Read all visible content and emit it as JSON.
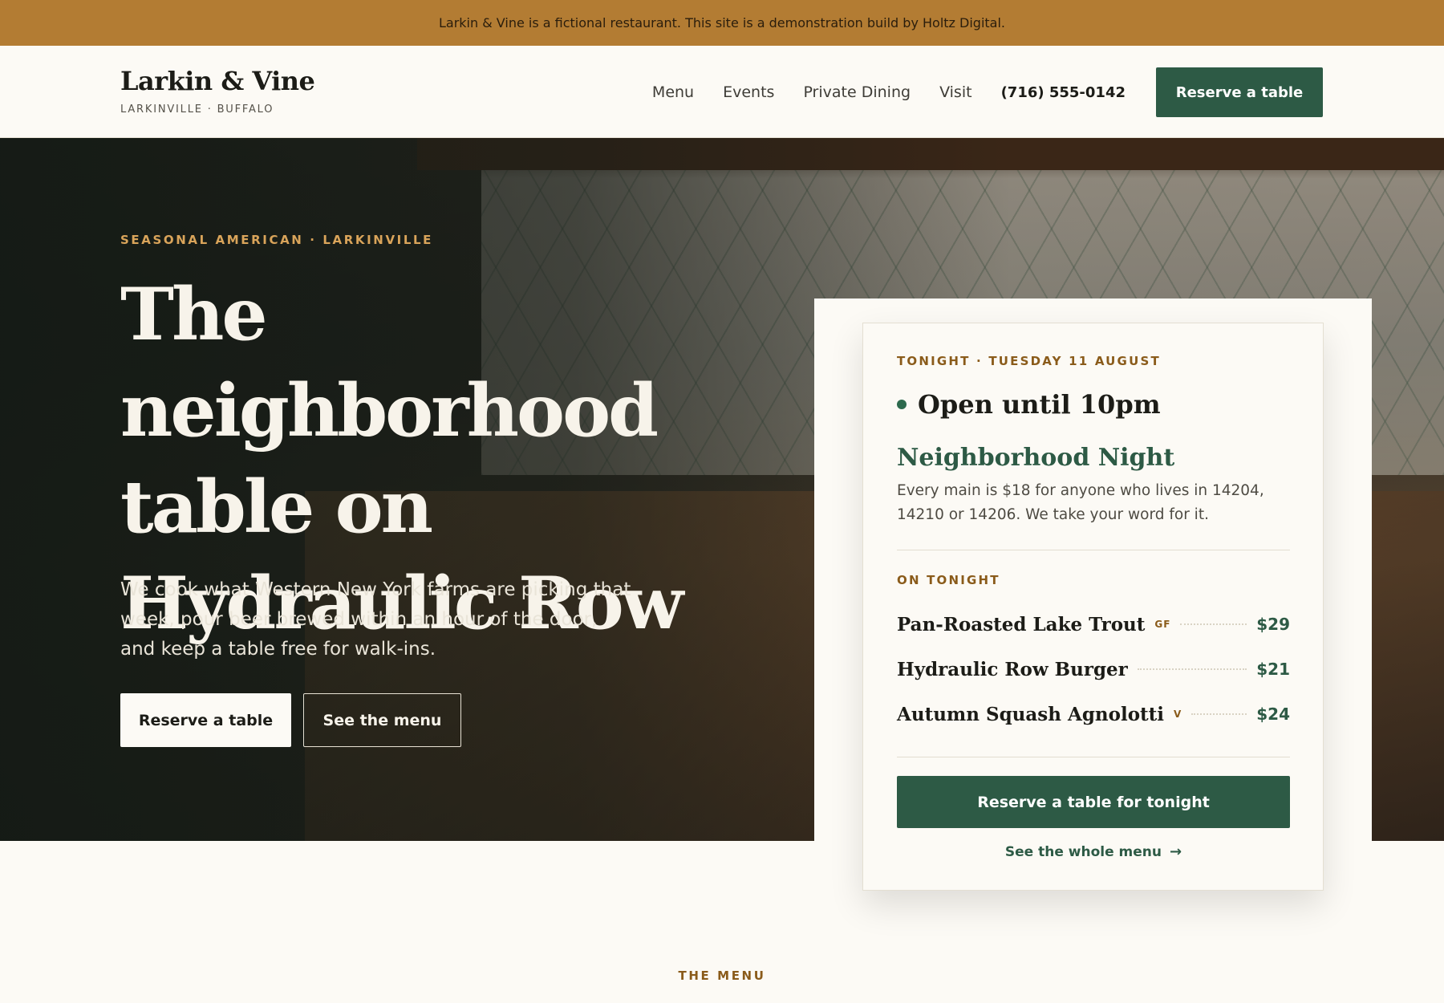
{
  "announcement": "Larkin & Vine is a fictional restaurant. This site is a demonstration build by Holtz Digital.",
  "brand": {
    "name": "Larkin & Vine",
    "sub": "LARKINVILLE · BUFFALO"
  },
  "nav": {
    "items": [
      {
        "label": "Menu"
      },
      {
        "label": "Events"
      },
      {
        "label": "Private Dining"
      },
      {
        "label": "Visit"
      }
    ],
    "phone": "(716) 555-0142",
    "reserve_label": "Reserve a table"
  },
  "hero": {
    "eyebrow": "SEASONAL AMERICAN · LARKINVILLE",
    "title": "The neighborhood table on Hydraulic Row",
    "lead": "We cook what Western New York farms are picking that week, pour beer brewed within an hour of the door, and keep a table free for walk-ins.",
    "primary_label": "Reserve a table",
    "secondary_label": "See the menu"
  },
  "card": {
    "eyebrow": "TONIGHT · TUESDAY 11 AUGUST",
    "status": "Open until 10pm",
    "promo_title": "Neighborhood Night",
    "promo_body": "Every main is $18 for anyone who lives in 14204, 14210 or 14206. We take your word for it.",
    "section_label": "ON TONIGHT",
    "dishes": [
      {
        "name": "Pan-Roasted Lake Trout",
        "tag": "GF",
        "price": "$29"
      },
      {
        "name": "Hydraulic Row Burger",
        "tag": "",
        "price": "$21"
      },
      {
        "name": "Autumn Squash Agnolotti",
        "tag": "V",
        "price": "$24"
      }
    ],
    "cta_label": "Reserve a table for tonight",
    "link_label": "See the whole menu",
    "link_icon": "→"
  },
  "menu_section": {
    "eyebrow": "THE MENU"
  },
  "colors": {
    "announce": "#b37c33",
    "accent_green": "#2d5a45",
    "gold": "#8a5b1a",
    "background": "#fcfaf5"
  }
}
